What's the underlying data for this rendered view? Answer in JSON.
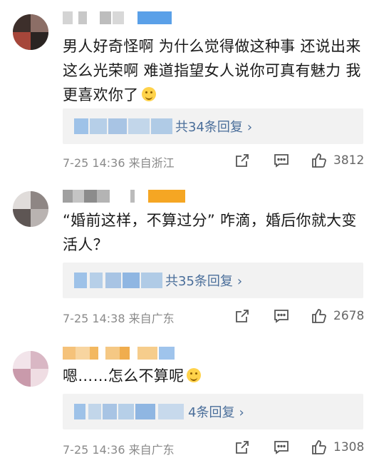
{
  "comments": [
    {
      "text": "男人好奇怪啊 为什么觉得做这种事 还说出来这么光荣啊 难道指望女人说你可真有魅力 我更喜欢你了",
      "replies_label": "共34条回复",
      "time": "7-25 14:36",
      "location": "来自浙江",
      "likes": "3812"
    },
    {
      "text": "“婚前这样，不算过分” 咋滴，婚后你就大变活人？",
      "replies_label": "共35条回复",
      "time": "7-25 14:38",
      "location": "来自广东",
      "likes": "2678"
    },
    {
      "text": "嗯……怎么不算呢",
      "replies_label": "4条回复",
      "time": "7-25 14:36",
      "location": "来自广东",
      "likes": "1308"
    }
  ],
  "icons": {
    "share": "share-icon",
    "comment": "comment-icon",
    "like": "thumbs-up-icon",
    "chevron": "chevron-right-icon",
    "emoji1": "grinning-sweat-emoji-icon",
    "emoji2": "smiling-face-emoji-icon"
  },
  "colors": {
    "link": "#4a6e9a",
    "meta": "#8a8a8a",
    "reply_bg": "#f2f2f2"
  }
}
